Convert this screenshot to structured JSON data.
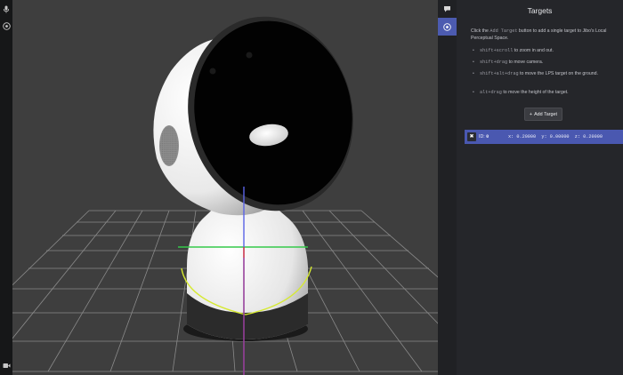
{
  "left_toolbar": {
    "icons": [
      "microphone-icon",
      "eye-icon",
      "camera-icon"
    ]
  },
  "panel_tabs": [
    "speech-bubble-icon",
    "eye-icon"
  ],
  "panel": {
    "title": "Targets",
    "intro_pre": "Click the ",
    "intro_code": "Add Target",
    "intro_post": " button to add a single target to Jibo's Local Perceptual Space.",
    "tips": [
      {
        "code": "shift+scroll",
        "text": " to zoom in and out."
      },
      {
        "code": "shift+drag",
        "text": " to move camera."
      },
      {
        "code": "shift+alt+drag",
        "text": " to move the LPS target on the ground."
      },
      {
        "code": "alt+drag",
        "text": " to move the height of the target."
      }
    ],
    "add_button_label": "Add Target",
    "targets": [
      {
        "id_label": "ID:",
        "id": "0",
        "x_label": "x:",
        "x": "0.20000",
        "y_label": "y:",
        "y": "0.00000",
        "z_label": "z:",
        "z": "0.20000"
      }
    ]
  },
  "colors": {
    "accent": "#4c5bb0",
    "viewport_bg": "#3e3e3e",
    "panel_bg": "#25262a",
    "grid": "#8a8a8a",
    "axis_x": "#e0373b",
    "axis_y": "#35c94a",
    "axis_z": "#5a63e6",
    "selection_ring": "#d6ea2f"
  }
}
